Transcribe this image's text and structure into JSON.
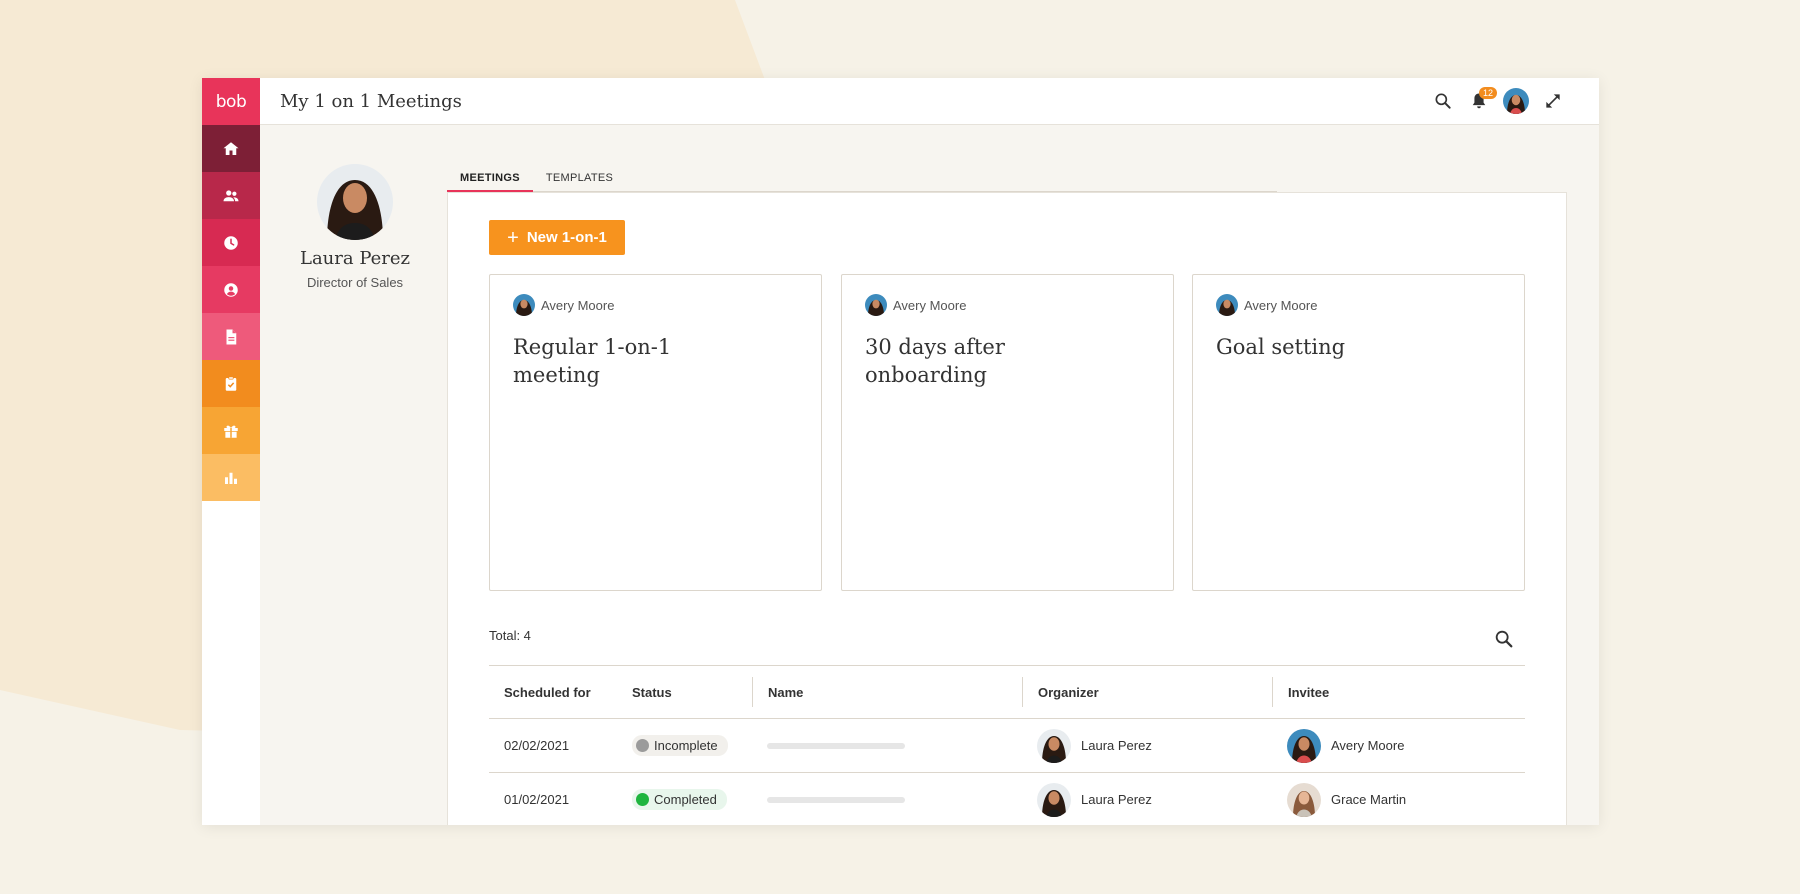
{
  "app": {
    "logo": "bob",
    "page_title": "My 1 on 1 Meetings",
    "notification_count": "12"
  },
  "rail": {
    "items": [
      {
        "name": "home-icon",
        "color": "#7d1f36"
      },
      {
        "name": "people-icon",
        "color": "#b8284a"
      },
      {
        "name": "clock-icon",
        "color": "#d72a52"
      },
      {
        "name": "person-circle-icon",
        "color": "#e63a62"
      },
      {
        "name": "document-icon",
        "color": "#ee5a7b"
      },
      {
        "name": "clipboard-check-icon",
        "color": "#f28c1e"
      },
      {
        "name": "gift-icon",
        "color": "#f7a534"
      },
      {
        "name": "bar-chart-icon",
        "color": "#fbbd63"
      }
    ]
  },
  "profile": {
    "name": "Laura Perez",
    "role": "Director of Sales"
  },
  "tabs": [
    {
      "label": "MEETINGS",
      "active": true
    },
    {
      "label": "TEMPLATES",
      "active": false
    }
  ],
  "new_button_label": "New 1-on-1",
  "cards": [
    {
      "owner": "Avery Moore",
      "title": "Regular 1-on-1 meeting"
    },
    {
      "owner": "Avery Moore",
      "title": "30 days after onboarding"
    },
    {
      "owner": "Avery Moore",
      "title": "Goal setting"
    }
  ],
  "total_label": "Total: 4",
  "table": {
    "headers": [
      "Scheduled for",
      "Status",
      "Name",
      "Organizer",
      "Invitee"
    ],
    "rows": [
      {
        "date": "02/02/2021",
        "status": "Incomplete",
        "organizer": "Laura Perez",
        "invitee": "Avery Moore"
      },
      {
        "date": "01/02/2021",
        "status": "Completed",
        "organizer": "Laura Perez",
        "invitee": "Grace Martin"
      }
    ]
  },
  "colors": {
    "brand_pink": "#e8345a",
    "accent_orange": "#f7931e",
    "status_complete": "#1fb53f",
    "status_incomplete": "#9b9b9b"
  }
}
